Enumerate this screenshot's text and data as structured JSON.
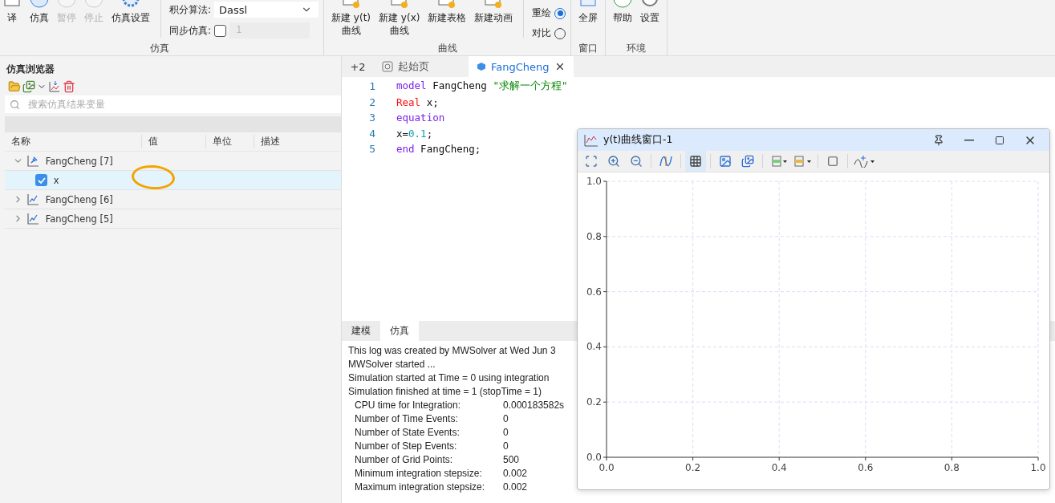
{
  "ribbon": {
    "sim_group": {
      "label": "仿真",
      "buttons": [
        {
          "lines": [
            "译"
          ],
          "disabled": false
        },
        {
          "lines": [
            "仿真"
          ],
          "disabled": false
        },
        {
          "lines": [
            "暂停"
          ],
          "disabled": true
        },
        {
          "lines": [
            "停止"
          ],
          "disabled": true
        },
        {
          "lines": [
            "仿真设置"
          ],
          "disabled": false
        }
      ],
      "solver": {
        "label": "积分算法:",
        "value": "Dassl"
      },
      "sync": {
        "label": "同步仿真:",
        "checked": false,
        "value": "1",
        "disabled": true
      }
    },
    "curve_group": {
      "label": "曲线",
      "buttons": [
        {
          "lines": [
            "新建 y(t)",
            "曲线"
          ]
        },
        {
          "lines": [
            "新建 y(x)",
            "曲线"
          ]
        },
        {
          "lines": [
            "新建表格"
          ]
        },
        {
          "lines": [
            "新建动画"
          ]
        }
      ],
      "modes": [
        {
          "label": "重绘",
          "selected": true
        },
        {
          "label": "对比",
          "selected": false
        }
      ]
    },
    "window_group": {
      "label": "窗口",
      "buttons": [
        {
          "lines": [
            "全屏"
          ]
        }
      ]
    },
    "env_group": {
      "label": "环境",
      "buttons": [
        {
          "lines": [
            "帮助"
          ]
        },
        {
          "lines": [
            "设置"
          ]
        }
      ]
    }
  },
  "browser": {
    "title": "仿真浏览器",
    "search_placeholder": "搜索仿真结果变量",
    "columns": [
      "名称",
      "值",
      "单位",
      "描述"
    ],
    "tree": [
      {
        "label": "FangCheng [7]",
        "pinned": true,
        "expanded": true,
        "selected": false,
        "children": [
          {
            "label": "x",
            "checked": true,
            "selected": true,
            "marked": true
          }
        ]
      },
      {
        "label": "FangCheng [6]",
        "pinned": false,
        "expanded": false,
        "selected": false
      },
      {
        "label": "FangCheng [5]",
        "pinned": false,
        "expanded": false,
        "selected": false
      }
    ]
  },
  "editor": {
    "overflow": "+2",
    "tabs": [
      {
        "label": "起始页",
        "selected": false,
        "closable": false
      },
      {
        "label": "FangCheng",
        "selected": true,
        "closable": true
      }
    ],
    "lines": [
      {
        "number": "1",
        "tokens": [
          {
            "text": "model",
            "kind": "keyword"
          },
          {
            "text": " FangCheng ",
            "kind": "plain"
          },
          {
            "text": "\"求解一个方程\"",
            "kind": "string"
          }
        ]
      },
      {
        "number": "2",
        "tokens": [
          {
            "text": "Real",
            "kind": "type"
          },
          {
            "text": " x;",
            "kind": "plain"
          }
        ]
      },
      {
        "number": "3",
        "tokens": [
          {
            "text": "equation",
            "kind": "keyword"
          }
        ]
      },
      {
        "number": "4",
        "tokens": [
          {
            "text": "x=",
            "kind": "plain"
          },
          {
            "text": "0.1",
            "kind": "number"
          },
          {
            "text": ";",
            "kind": "plain"
          }
        ]
      },
      {
        "number": "5",
        "tokens": [
          {
            "text": "end",
            "kind": "keyword"
          },
          {
            "text": " FangCheng;",
            "kind": "plain"
          }
        ]
      }
    ]
  },
  "log": {
    "tabs": [
      {
        "label": "建模",
        "selected": false
      },
      {
        "label": "仿真",
        "selected": true
      }
    ],
    "lines": [
      "This log was created by MWSolver at Wed Jun  3",
      "MWSolver started ...",
      "Simulation started at Time = 0 using integration",
      "Simulation finished at time = 1 (stopTime = 1)"
    ],
    "stats": [
      {
        "label": "CPU time for Integration:",
        "value": "0.000183582s"
      },
      {
        "label": "Number of Time Events:",
        "value": "0"
      },
      {
        "label": "Number of State Events:",
        "value": "0"
      },
      {
        "label": "Number of Step Events:",
        "value": "0"
      },
      {
        "label": "Number of Grid Points:",
        "value": "500"
      },
      {
        "label": "Minimum integration stepsize:",
        "value": "0.002"
      },
      {
        "label": "Maximum integration stepsize:",
        "value": "0.002"
      }
    ]
  },
  "plot": {
    "title": "y(t)曲线窗口-1",
    "grid_on": true,
    "chart_data": {
      "type": "line",
      "grid": true,
      "xlim": [
        0,
        1
      ],
      "ylim": [
        0,
        1
      ],
      "xticks": [
        {
          "value": 0,
          "label": "0.0"
        },
        {
          "value": 0.2,
          "label": "0.2"
        },
        {
          "value": 0.4,
          "label": "0.4"
        },
        {
          "value": 0.6,
          "label": "0.6"
        },
        {
          "value": 0.8,
          "label": "0.8"
        },
        {
          "value": 1,
          "label": "1.0"
        }
      ],
      "yticks": [
        {
          "value": 0,
          "label": "0.0"
        },
        {
          "value": 0.2,
          "label": "0.2"
        },
        {
          "value": 0.4,
          "label": "0.4"
        },
        {
          "value": 0.6,
          "label": "0.6"
        },
        {
          "value": 0.8,
          "label": "0.8"
        },
        {
          "value": 1,
          "label": "1.0"
        }
      ]
    }
  }
}
